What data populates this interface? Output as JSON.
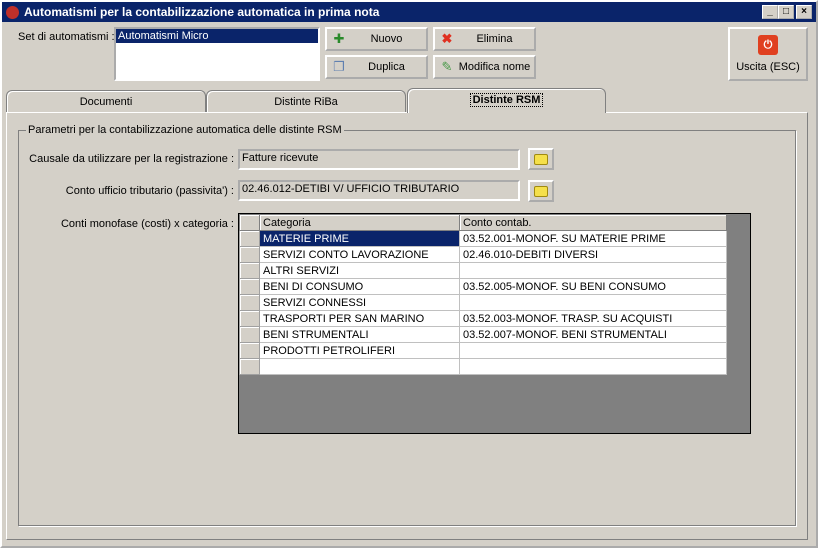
{
  "window": {
    "title": "Automatismi per la contabilizzazione automatica in prima nota",
    "minimize": "_",
    "maximize": "□",
    "close": "×"
  },
  "set": {
    "label": "Set di automatismi :",
    "items": [
      "Automatismi Micro"
    ],
    "selected": "Automatismi Micro"
  },
  "buttons": {
    "nuovo": "Nuovo",
    "elimina": "Elimina",
    "duplica": "Duplica",
    "modifica": "Modifica nome",
    "uscita": "Uscita (ESC)"
  },
  "tabs": [
    {
      "label": "Documenti"
    },
    {
      "label": "Distinte RiBa"
    },
    {
      "label": "Distinte RSM",
      "active": true
    }
  ],
  "group": {
    "legend": "Parametri per la contabilizzazione automatica delle distinte RSM"
  },
  "causale": {
    "label": "Causale da utilizzare per la registrazione :",
    "value": "Fatture ricevute"
  },
  "conto": {
    "label": "Conto ufficio tributario (passivita') :",
    "value": "02.46.012-DETIBI V/ UFFICIO TRIBUTARIO"
  },
  "grid": {
    "label": "Conti monofase (costi) x categoria :",
    "columns": [
      "Categoria",
      "Conto contab."
    ],
    "rows": [
      [
        "MATERIE PRIME",
        "03.52.001-MONOF. SU MATERIE PRIME"
      ],
      [
        "SERVIZI CONTO LAVORAZIONE",
        "02.46.010-DEBITI DIVERSI"
      ],
      [
        "ALTRI SERVIZI",
        ""
      ],
      [
        "BENI DI CONSUMO",
        "03.52.005-MONOF. SU BENI CONSUMO"
      ],
      [
        "SERVIZI CONNESSI",
        ""
      ],
      [
        "TRASPORTI PER SAN MARINO",
        "03.52.003-MONOF. TRASP. SU ACQUISTI"
      ],
      [
        "BENI STRUMENTALI",
        "03.52.007-MONOF. BENI STRUMENTALI"
      ],
      [
        "PRODOTTI PETROLIFERI",
        ""
      ],
      [
        "",
        ""
      ]
    ],
    "selected_row": 0
  },
  "colors": {
    "titlebar": "#0a246a",
    "selection": "#0a246a",
    "face": "#d4d0c8"
  }
}
